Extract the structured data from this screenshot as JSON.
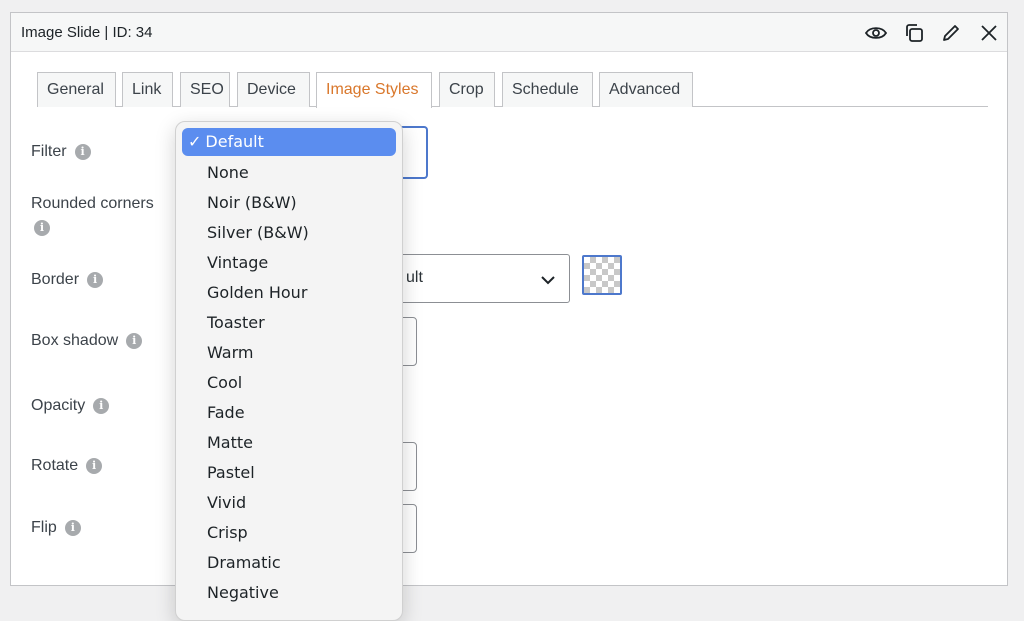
{
  "panel": {
    "title": "Image Slide | ID: 34"
  },
  "header_icons": [
    "eye-icon",
    "copy-icon",
    "pencil-icon",
    "close-icon"
  ],
  "tabs": [
    {
      "label": "General"
    },
    {
      "label": "Link"
    },
    {
      "label": "SEO"
    },
    {
      "label": "Device"
    },
    {
      "label": "Image Styles",
      "active": true
    },
    {
      "label": "Crop"
    },
    {
      "label": "Schedule"
    },
    {
      "label": "Advanced"
    }
  ],
  "fields": {
    "filter": "Filter",
    "rounded_corners_line1": "Rounded corners",
    "border": "Border",
    "box_shadow": "Box shadow",
    "opacity": "Opacity",
    "rotate": "Rotate",
    "flip": "Flip"
  },
  "border_select": {
    "value_visible": "ult"
  },
  "filter_dropdown": {
    "selected_mark": "✓",
    "options": [
      "Default",
      "None",
      "Noir (B&W)",
      "Silver (B&W)",
      "Vintage",
      "Golden Hour",
      "Toaster",
      "Warm",
      "Cool",
      "Fade",
      "Matte",
      "Pastel",
      "Vivid",
      "Crisp",
      "Dramatic",
      "Negative"
    ],
    "selected_index": 0
  },
  "colors": {
    "accent_tab": "#d9772b",
    "selected_option": "#5b8def",
    "focus_border": "#4d78cc"
  }
}
